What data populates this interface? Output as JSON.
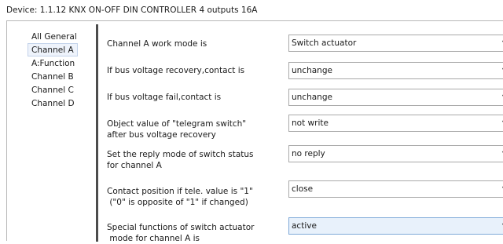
{
  "device_title": "Device: 1.1.12  KNX ON-OFF DIN CONTROLLER 4 outputs 16A",
  "sidebar": {
    "items": [
      {
        "label": "All General",
        "selected": false
      },
      {
        "label": "Channel A",
        "selected": true
      },
      {
        "label": "A:Function",
        "selected": false
      },
      {
        "label": "Channel B",
        "selected": false
      },
      {
        "label": "Channel C",
        "selected": false
      },
      {
        "label": "Channel D",
        "selected": false
      }
    ]
  },
  "params": [
    {
      "label_lines": [
        "Channel A work mode is"
      ],
      "value": "Switch actuator"
    },
    {
      "label_lines": [
        "If bus voltage recovery,contact is"
      ],
      "value": "unchange"
    },
    {
      "label_lines": [
        "If bus voltage fail,contact is"
      ],
      "value": "unchange"
    },
    {
      "label_lines": [
        "Object value of \"telegram switch\"",
        "after bus voltage recovery"
      ],
      "value": "not write"
    },
    {
      "label_lines": [
        "Set the reply mode of switch status",
        "for channel A"
      ],
      "value": "no reply"
    },
    {
      "label_lines": [
        "Contact position if tele. value is \"1\"",
        " (\"0\" is opposite of \"1\" if changed)"
      ],
      "value": "close"
    },
    {
      "label_lines": [
        "Special functions of switch actuator",
        " mode for channel A is"
      ],
      "value": "active"
    }
  ],
  "icons": {
    "dropdown": "chevron-down-icon"
  },
  "colors": {
    "divider": "#4c4c4c",
    "selected_nav_bg": "#eef3fb",
    "active_select_bg": "#e8f1fb"
  }
}
